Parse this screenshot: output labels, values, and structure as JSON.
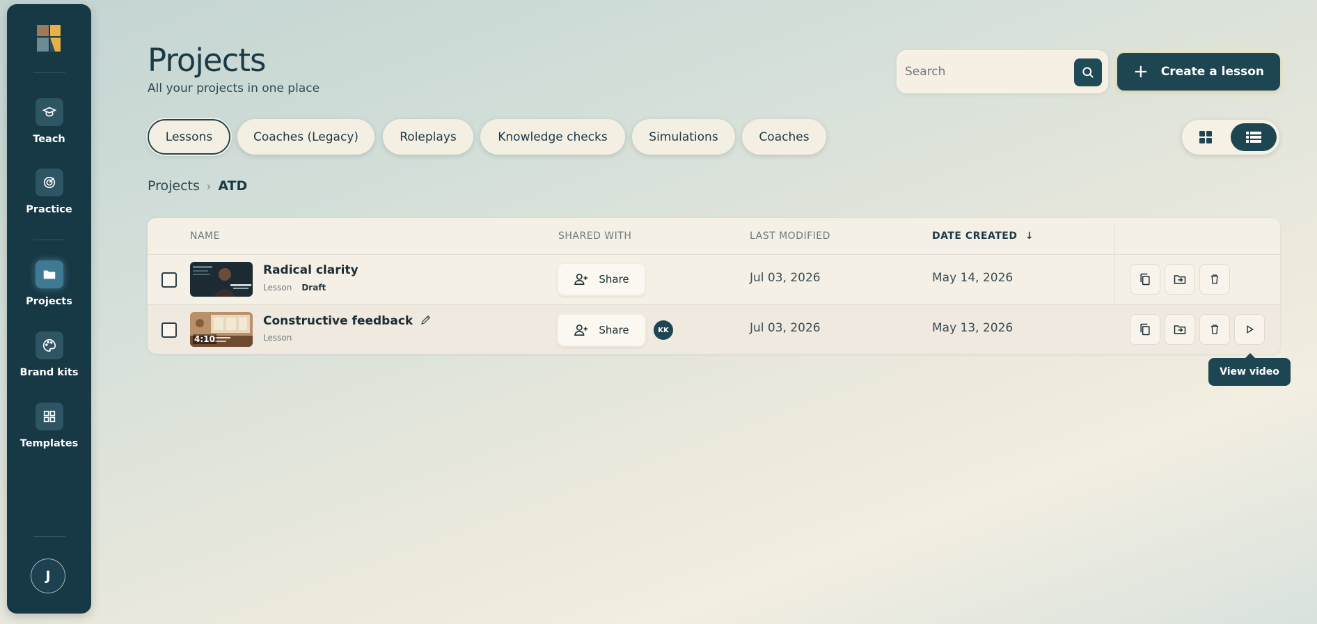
{
  "sidebar": {
    "items": [
      {
        "label": "Teach",
        "icon": "graduation-cap-icon"
      },
      {
        "label": "Practice",
        "icon": "target-icon"
      },
      {
        "label": "Projects",
        "icon": "folder-icon",
        "active": true
      },
      {
        "label": "Brand kits",
        "icon": "palette-icon"
      },
      {
        "label": "Templates",
        "icon": "grid-icon"
      }
    ],
    "user_initial": "J"
  },
  "header": {
    "title": "Projects",
    "subtitle": "All your projects in one place",
    "search_placeholder": "Search",
    "create_label": "Create a lesson"
  },
  "tabs": [
    {
      "label": "Lessons",
      "active": true
    },
    {
      "label": "Coaches (Legacy)"
    },
    {
      "label": "Roleplays"
    },
    {
      "label": "Knowledge checks"
    },
    {
      "label": "Simulations"
    },
    {
      "label": "Coaches"
    }
  ],
  "breadcrumb": {
    "root": "Projects",
    "separator": "›",
    "current": "ATD"
  },
  "table": {
    "columns": {
      "name": "NAME",
      "shared_with": "SHARED WITH",
      "last_modified": "LAST MODIFIED",
      "date_created": "DATE CREATED"
    },
    "sort_indicator": "↓",
    "rows": [
      {
        "name": "Radical clarity",
        "type": "Lesson",
        "status": "Draft",
        "share_label": "Share",
        "shared_initials": "",
        "last_modified": "Jul 03, 2026",
        "date_created": "May 14, 2026"
      },
      {
        "name": "Constructive feedback",
        "type": "Lesson",
        "status": "",
        "duration": "4:10",
        "share_label": "Share",
        "shared_initials": "KK",
        "last_modified": "Jul 03, 2026",
        "date_created": "May 13, 2026"
      }
    ]
  },
  "tooltip": {
    "label": "View video"
  },
  "colors": {
    "sidebar": "#173845",
    "accent": "#1d4652",
    "surface": "#f5f0e6"
  }
}
